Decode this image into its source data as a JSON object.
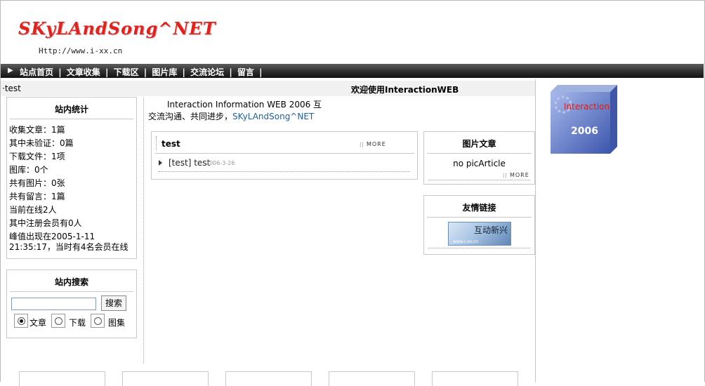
{
  "header": {
    "logo_text": "SKyLAndSong^NET",
    "url_text": "Http://www.i-xx.cn"
  },
  "nav": {
    "items": [
      "站点首页",
      "文章收集",
      "下载区",
      "图片库",
      "交流论坛",
      "留言"
    ],
    "separator": "|"
  },
  "titlebar": {
    "crumb": "·test",
    "welcome": "欢迎使用InteractionWEB"
  },
  "stats": {
    "title": "站内统计",
    "lines": [
      "收集文章：1篇",
      "其中未验证：0篇",
      "下载文件：1项",
      "图库：0个",
      "共有图片：0张",
      "共有留言：1篇",
      "当前在线2人",
      "其中注册会员有0人",
      "峰值出现在2005-1-11",
      "21:35:17，当时有4名会员在线"
    ]
  },
  "search": {
    "title": "站内搜索",
    "button": "搜索",
    "input_value": "",
    "options": [
      {
        "label": "文章",
        "checked": true
      },
      {
        "label": "下载",
        "checked": false
      },
      {
        "label": "图集",
        "checked": false
      }
    ]
  },
  "intro": {
    "line1": "Interaction Information WEB 2006 互",
    "line2_prefix": "交流沟通、共同进步，",
    "line2_link": "SKyLAndSong^NET"
  },
  "article_panel": {
    "title": "test",
    "more": "MORE",
    "items": [
      {
        "title": "[test] test",
        "date": "2006-3-26"
      }
    ]
  },
  "picture_panel": {
    "title": "图片文章",
    "empty": "no picArticle",
    "more": "MORE"
  },
  "links_panel": {
    "title": "友情链接",
    "banner_text": "互动新兴",
    "banner_sub": "www.i-xx.cn"
  },
  "cube": {
    "label": "Interaction",
    "year": "2006"
  },
  "colors": {
    "logo": "#e5211c",
    "link": "#1f5fa6",
    "nav_bg": "#2e2e2e"
  }
}
